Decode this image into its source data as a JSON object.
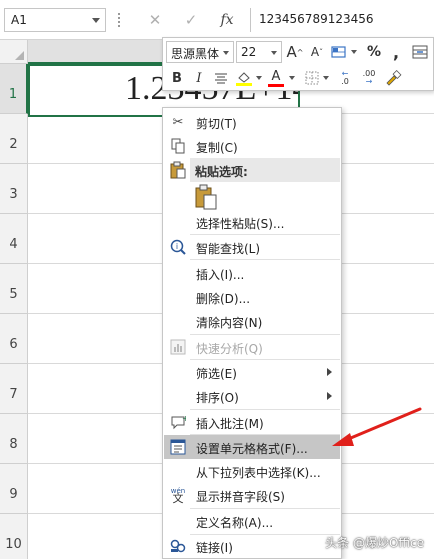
{
  "formula_bar": {
    "name_box": "A1",
    "cancel_glyph": "✕",
    "enter_glyph": "✓",
    "fx_label": "fx",
    "formula_value": "123456789123456"
  },
  "grid": {
    "row_numbers": [
      "1",
      "2",
      "3",
      "4",
      "5",
      "6",
      "7",
      "8",
      "9",
      "10"
    ],
    "cell_a1_display": "1.23457E+14",
    "selection_color": "#217346"
  },
  "mini_toolbar": {
    "font_name": "思源黑体",
    "font_size": "22",
    "increase_font": "A",
    "decrease_font": "A",
    "percent": "%",
    "comma": ",",
    "bold": "B",
    "italic": "I",
    "font_color_letter": "A",
    "decimal_increase": ".0",
    "decimal_decrease": ".00",
    "highlight_color": "#ffff00",
    "font_color": "#ff0000"
  },
  "context_menu": {
    "items": [
      {
        "label": "剪切(T)",
        "icon": "scissors-icon"
      },
      {
        "label": "复制(C)",
        "icon": "copy-icon"
      },
      {
        "label": "粘贴选项:",
        "icon": "clipboard-icon"
      },
      {
        "label": "选择性粘贴(S)...",
        "icon": ""
      },
      {
        "label": "智能查找(L)",
        "icon": "smart-lookup-icon"
      },
      {
        "label": "插入(I)...",
        "icon": ""
      },
      {
        "label": "删除(D)...",
        "icon": ""
      },
      {
        "label": "清除内容(N)",
        "icon": ""
      },
      {
        "label": "快速分析(Q)",
        "icon": "quick-analysis-icon"
      },
      {
        "label": "筛选(E)",
        "icon": ""
      },
      {
        "label": "排序(O)",
        "icon": ""
      },
      {
        "label": "插入批注(M)",
        "icon": "comment-icon"
      },
      {
        "label": "设置单元格格式(F)...",
        "icon": "format-cells-icon"
      },
      {
        "label": "从下拉列表中选择(K)...",
        "icon": ""
      },
      {
        "label": "显示拼音字段(S)",
        "icon": "phonetic-icon"
      },
      {
        "label": "定义名称(A)...",
        "icon": ""
      },
      {
        "label": "链接(I)",
        "icon": "link-icon"
      }
    ],
    "highlighted_item": "设置单元格格式(F)...",
    "annotation_arrow_color": "#e0201b"
  },
  "watermark": "头条 @爆炒Office"
}
